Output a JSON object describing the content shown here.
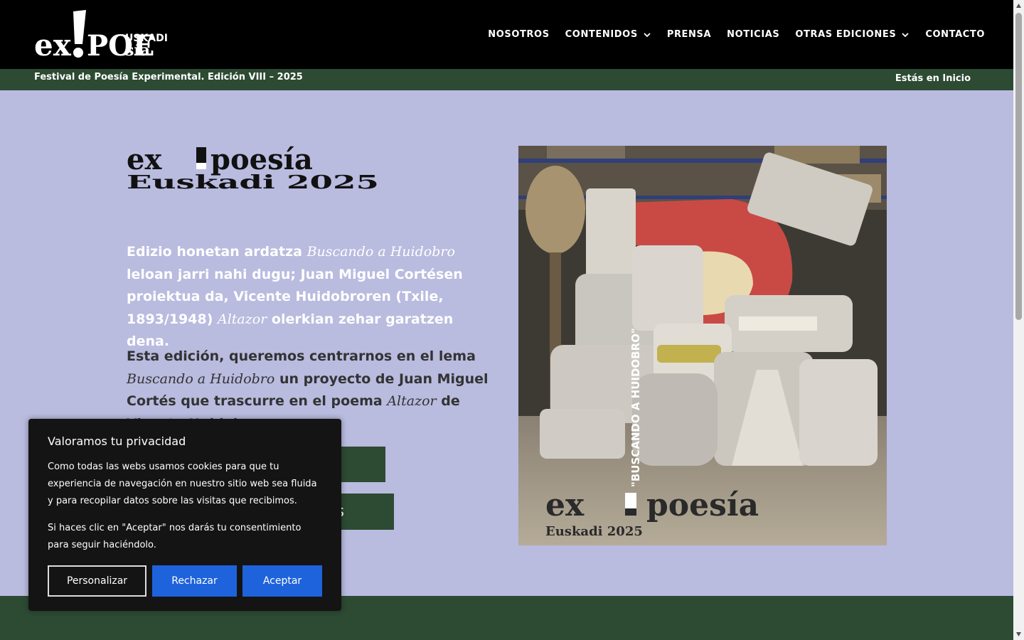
{
  "header": {
    "logo_text": "ex!POESÍA EUSKADI",
    "nav": [
      {
        "label": "NOSOTROS",
        "has_dropdown": false
      },
      {
        "label": "CONTENIDOS",
        "has_dropdown": true
      },
      {
        "label": "PRENSA",
        "has_dropdown": false
      },
      {
        "label": "NOTICIAS",
        "has_dropdown": false
      },
      {
        "label": "OTRAS EDICIONES",
        "has_dropdown": true
      },
      {
        "label": "CONTACTO",
        "has_dropdown": false
      }
    ]
  },
  "subbar": {
    "left_text": "Festival de Poesía Experimental. Edición VIII – 2025",
    "right_text": "Estás en Inicio"
  },
  "main": {
    "logo_line1": "ex!poesía",
    "logo_line2": "Euskadi 2025",
    "p1": {
      "a": "Edizio honetan ardatza ",
      "em1": "Buscando a Huidobro",
      "b": " leloan jarri nahi dugu; Juan Miguel Cortésen proiektua da, Vicente Huidobroren (Txile, 1893/1948) ",
      "em2": "Altazor",
      "c": " olerkian zehar garatzen dena."
    },
    "p2": {
      "a": "Esta edición, queremos centrarnos en el lema ",
      "em1": "Buscando a Huidobro",
      "b": " un proyecto de Juan Miguel Cortés que trascurre en el poema ",
      "em2": "Altazor",
      "c": " de Vicente Huidobro"
    },
    "button1_label": "ITES",
    "button2_label": "ortés"
  },
  "poster": {
    "vertical_text": "\"BUSCANDO A HUIDOBRO\"",
    "title": "ex!poesía",
    "subtitle": "Euskadi 2025"
  },
  "cookie": {
    "title": "Valoramos tu privacidad",
    "text1": "Como todas las webs usamos cookies para que tu experiencia de navegación en nuestro sitio web sea fluida y para recopilar datos sobre las visitas que recibimos.",
    "text2": "Si haces clic en \"Aceptar\" nos darás tu consentimiento para seguir haciéndolo.",
    "btn_customize": "Personalizar",
    "btn_reject": "Rechazar",
    "btn_accept": "Aceptar"
  },
  "colors": {
    "header_bg": "#000000",
    "green": "#2d4a33",
    "page_bg": "#b9bbdf",
    "accent_blue": "#1e63db"
  }
}
